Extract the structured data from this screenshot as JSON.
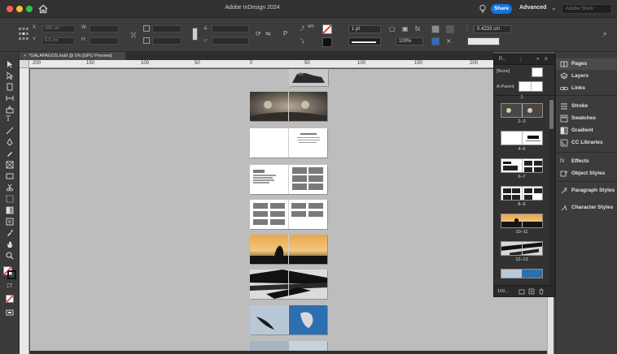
{
  "window": {
    "title": "Adobe InDesign 2024",
    "share_label": "Share",
    "workspace": "Advanced",
    "search_placeholder": "Adobe Stock"
  },
  "control": {
    "x_value": "165 cm",
    "y_value": "6.5 cm",
    "stroke_weight": "1 pt",
    "zoom": "100%",
    "width_value": "0.4233 cm"
  },
  "document": {
    "tab_label": "*GALAPAGOS.indd @ 5% [GPU Preview]"
  },
  "ruler": {
    "h_labels": [
      "200",
      "150",
      "100",
      "50",
      "0",
      "50",
      "100",
      "150",
      "200"
    ]
  },
  "pages_panel": {
    "tab_pages": "P...",
    "master_none": "[None]",
    "master_a": "A-Parent",
    "page_one": "1",
    "spreads": [
      {
        "label": "2–3"
      },
      {
        "label": "4–5"
      },
      {
        "label": "6–7"
      },
      {
        "label": "8–9"
      },
      {
        "label": "10–11"
      },
      {
        "label": "12–13"
      }
    ],
    "footer_text": "169..."
  },
  "dock": {
    "items": [
      {
        "label": "Pages",
        "icon": "pages-icon"
      },
      {
        "label": "Layers",
        "icon": "layers-icon"
      },
      {
        "label": "Links",
        "icon": "links-icon"
      },
      {
        "label": "Stroke",
        "icon": "stroke-icon"
      },
      {
        "label": "Swatches",
        "icon": "swatches-icon"
      },
      {
        "label": "Gradient",
        "icon": "gradient-icon"
      },
      {
        "label": "CC Libraries",
        "icon": "cc-libraries-icon"
      },
      {
        "label": "Effects",
        "icon": "effects-icon"
      },
      {
        "label": "Object Styles",
        "icon": "object-styles-icon"
      },
      {
        "label": "Paragraph Styles",
        "icon": "paragraph-styles-icon"
      },
      {
        "label": "Character Styles",
        "icon": "character-styles-icon"
      }
    ]
  },
  "colors": {
    "accent": "#1473e6",
    "pasteboard": "#bdbdbd",
    "panel": "#3c3c3c"
  }
}
